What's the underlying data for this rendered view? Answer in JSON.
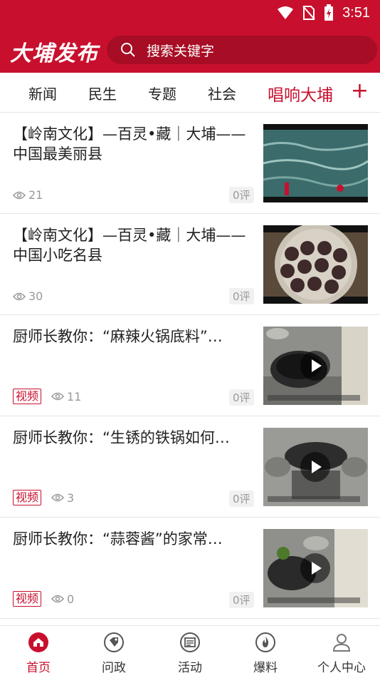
{
  "status_bar": {
    "time": "3:51"
  },
  "header": {
    "logo": "大埔发布",
    "search_placeholder": "搜索关键字"
  },
  "tabs": [
    {
      "label": "新闻"
    },
    {
      "label": "民生"
    },
    {
      "label": "专题"
    },
    {
      "label": "社会"
    },
    {
      "label": "唱响大埔"
    }
  ],
  "tab_plus": "+",
  "articles": [
    {
      "title": "【岭南文化】—百灵•藏｜大埔——中国最美丽县",
      "views": "21",
      "comments": "0评",
      "video": false
    },
    {
      "title": "【岭南文化】—百灵•藏｜大埔——中国小吃名县",
      "views": "30",
      "comments": "0评",
      "video": false
    },
    {
      "title": "厨师长教你：“麻辣火锅底料”…",
      "views": "11",
      "comments": "0评",
      "video": true,
      "badge": "视频"
    },
    {
      "title": "厨师长教你：“生锈的铁锅如何…",
      "views": "3",
      "comments": "0评",
      "video": true,
      "badge": "视频"
    },
    {
      "title": "厨师长教你：“蒜蓉酱”的家常…",
      "views": "0",
      "comments": "0评",
      "video": true,
      "badge": "视频"
    }
  ],
  "bottom_nav": [
    {
      "label": "首页",
      "icon": "home-icon",
      "active": true
    },
    {
      "label": "问政",
      "icon": "tag-icon"
    },
    {
      "label": "活动",
      "icon": "newspaper-icon"
    },
    {
      "label": "爆料",
      "icon": "fire-icon"
    },
    {
      "label": "个人中心",
      "icon": "user-icon"
    }
  ],
  "colors": {
    "brand": "#c8102e",
    "muted": "#999999"
  }
}
